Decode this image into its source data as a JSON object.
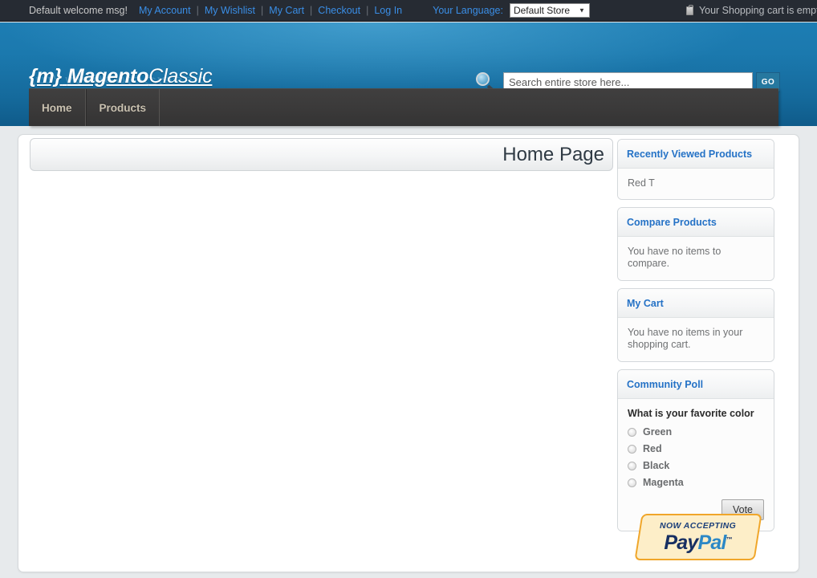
{
  "topbar": {
    "welcome": "Default welcome msg!",
    "links": [
      {
        "label": "My Account"
      },
      {
        "label": "My Wishlist"
      },
      {
        "label": "My Cart"
      },
      {
        "label": "Checkout"
      },
      {
        "label": "Log In"
      }
    ],
    "separator": "|",
    "language_label": "Your Language:",
    "language_selected": "Default Store",
    "language_options": [
      "Default Store"
    ],
    "language_caret": "▼",
    "cart_icon": "shopping-cart-icon",
    "cart_status": "Your Shopping cart is empty."
  },
  "header": {
    "logo_brace_open": "{m}",
    "logo_magento": "Magento",
    "logo_classic": "Classic",
    "logo_full": "{m} MagentoClassic",
    "search_icon": "magnifier-icon",
    "search_placeholder": "Search entire store here...",
    "search_value": "",
    "go_label": "GO"
  },
  "nav": {
    "items": [
      {
        "label": "Home",
        "name": "nav-item-home"
      },
      {
        "label": "Products",
        "name": "nav-item-products"
      }
    ]
  },
  "main": {
    "page_title": "Home Page"
  },
  "sidebar": {
    "blocks": [
      {
        "name": "recently-viewed-products",
        "title": "Recently Viewed Products",
        "items": [
          "Red T"
        ]
      },
      {
        "name": "compare-products",
        "title": "Compare Products",
        "empty_text": "You have no items to compare."
      },
      {
        "name": "my-cart",
        "title": "My Cart",
        "empty_text": "You have no items in your shopping cart."
      },
      {
        "name": "community-poll",
        "title": "Community Poll",
        "question": "What is your favorite color",
        "options": [
          "Green",
          "Red",
          "Black",
          "Magenta"
        ],
        "vote_label": "Vote"
      }
    ]
  },
  "paypal": {
    "now_accepting": "NOW ACCEPTING",
    "pay": "Pay",
    "pal": "Pal",
    "tm": "™"
  },
  "colors": {
    "topbar_bg": "#262b33",
    "link_blue": "#3a8ee6",
    "header_blue": "#156a9c",
    "nav_dark": "#3b3a3a",
    "block_title_blue": "#2572c6",
    "paypal_cream": "#fdeec8",
    "paypal_orange": "#f0a62a"
  }
}
